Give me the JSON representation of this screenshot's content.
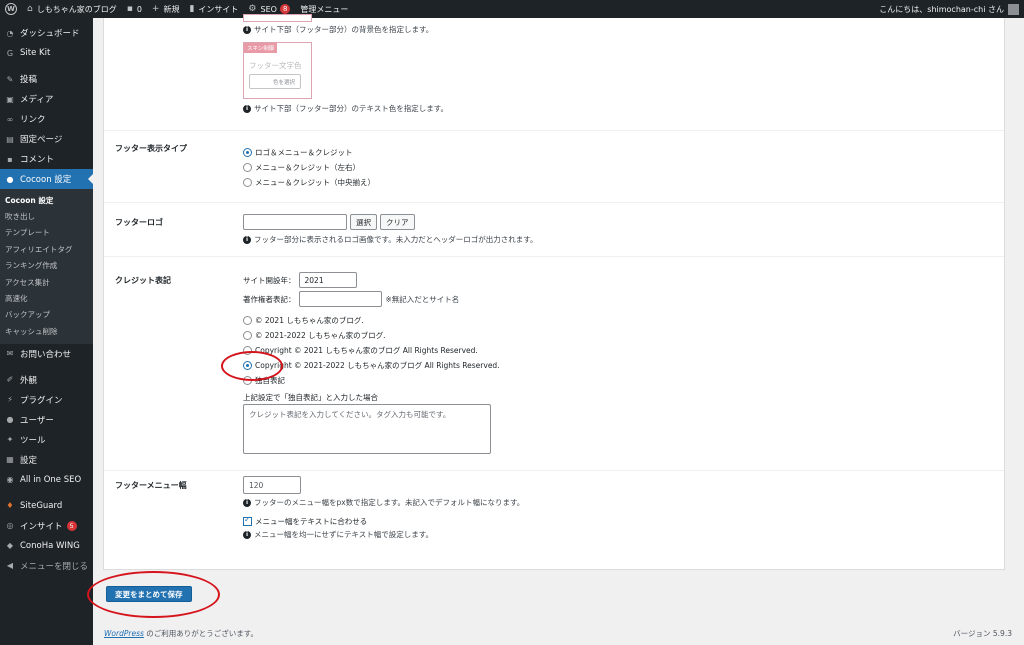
{
  "adminbar": {
    "site_name": "しもちゃん家のブログ",
    "comments_count": "0",
    "new_label": "新規",
    "insight_label": "インサイト",
    "seo_label": "SEO",
    "seo_count": "8",
    "admin_menu_label": "管理メニュー",
    "greeting": "こんにちは、shimochan-chi さん"
  },
  "sidebar": {
    "items": [
      {
        "label": "ダッシュボード",
        "icon": "dashboard-icon"
      },
      {
        "label": "Site Kit",
        "icon": "sitekit-icon"
      },
      {
        "label": "投稿",
        "icon": "pin-icon"
      },
      {
        "label": "メディア",
        "icon": "media-icon"
      },
      {
        "label": "リンク",
        "icon": "link-icon"
      },
      {
        "label": "固定ページ",
        "icon": "page-icon"
      },
      {
        "label": "コメント",
        "icon": "comment-icon"
      },
      {
        "label": "Cocoon 設定",
        "icon": "cocoon-icon"
      }
    ],
    "submenu": [
      "Cocoon 設定",
      "吹き出し",
      "テンプレート",
      "アフィリエイトタグ",
      "ランキング作成",
      "アクセス集計",
      "高速化",
      "バックアップ",
      "キャッシュ削除"
    ],
    "items2": [
      {
        "label": "お問い合わせ",
        "icon": "mail-icon"
      },
      {
        "label": "外観",
        "icon": "brush-icon"
      },
      {
        "label": "プラグイン",
        "icon": "plugin-icon"
      },
      {
        "label": "ユーザー",
        "icon": "user-icon"
      },
      {
        "label": "ツール",
        "icon": "wrench-icon"
      },
      {
        "label": "設定",
        "icon": "settings-icon"
      },
      {
        "label": "All in One SEO",
        "icon": "aioseo-icon"
      }
    ],
    "items3": [
      {
        "label": "SiteGuard",
        "icon": "shield-icon"
      },
      {
        "label": "インサイト",
        "icon": "insight-icon",
        "count": "5"
      },
      {
        "label": "ConoHa WING",
        "icon": "conoha-icon"
      },
      {
        "label": "メニューを閉じる",
        "icon": "collapse-icon"
      }
    ]
  },
  "footer_bg": {
    "note": "サイト下部（フッター部分）の背景色を指定します。"
  },
  "footer_text_color": {
    "skin_tag": "スキン制御",
    "preview_label": "フッター文字色",
    "color_button": "色を選択",
    "note": "サイト下部（フッター部分）のテキスト色を指定します。"
  },
  "footer_display_type": {
    "label": "フッター表示タイプ",
    "options": [
      "ロゴ＆メニュー＆クレジット",
      "メニュー＆クレジット（左右）",
      "メニュー＆クレジット（中央揃え）"
    ],
    "selected_index": 0
  },
  "footer_logo": {
    "label": "フッターロゴ",
    "select_button": "選択",
    "clear_button": "クリア",
    "note": "フッター部分に表示されるロゴ画像です。未入力だとヘッダーロゴが出力されます。"
  },
  "credit": {
    "label": "クレジット表記",
    "year_label": "サイト開設年：",
    "year_value": "2021",
    "author_label": "著作権者表記：",
    "author_value": "",
    "author_hint": "※無記入だとサイト名",
    "options": [
      "© 2021 しもちゃん家のブログ.",
      "© 2021-2022 しもちゃん家のブログ.",
      "Copyright © 2021 しもちゃん家のブログ All Rights Reserved.",
      "Copyright © 2021-2022 しもちゃん家のブログ All Rights Reserved.",
      "独自表記"
    ],
    "selected_index": 3,
    "custom_label": "上記設定で「独自表記」と入力した場合",
    "custom_placeholder": "クレジット表記を入力してください。タグ入力も可能です。"
  },
  "footer_menu_width": {
    "label": "フッターメニュー幅",
    "value": "120",
    "note": "フッターのメニュー幅をpx数で指定します。未記入でデフォルト幅になります。",
    "checkbox_label": "メニュー幅をテキストに合わせる",
    "checkbox_checked": true,
    "note2": "メニュー幅を均一にせずにテキスト幅で設定します。"
  },
  "save_button": "変更をまとめて保存",
  "footer": {
    "wordpress_link": "WordPress",
    "thanks": " のご利用ありがとうございます。",
    "version": "バージョン 5.9.3"
  },
  "colors": {
    "adminbar_bg": "#1d2327",
    "accent": "#2271b1",
    "annotation_red": "#d5141c"
  }
}
